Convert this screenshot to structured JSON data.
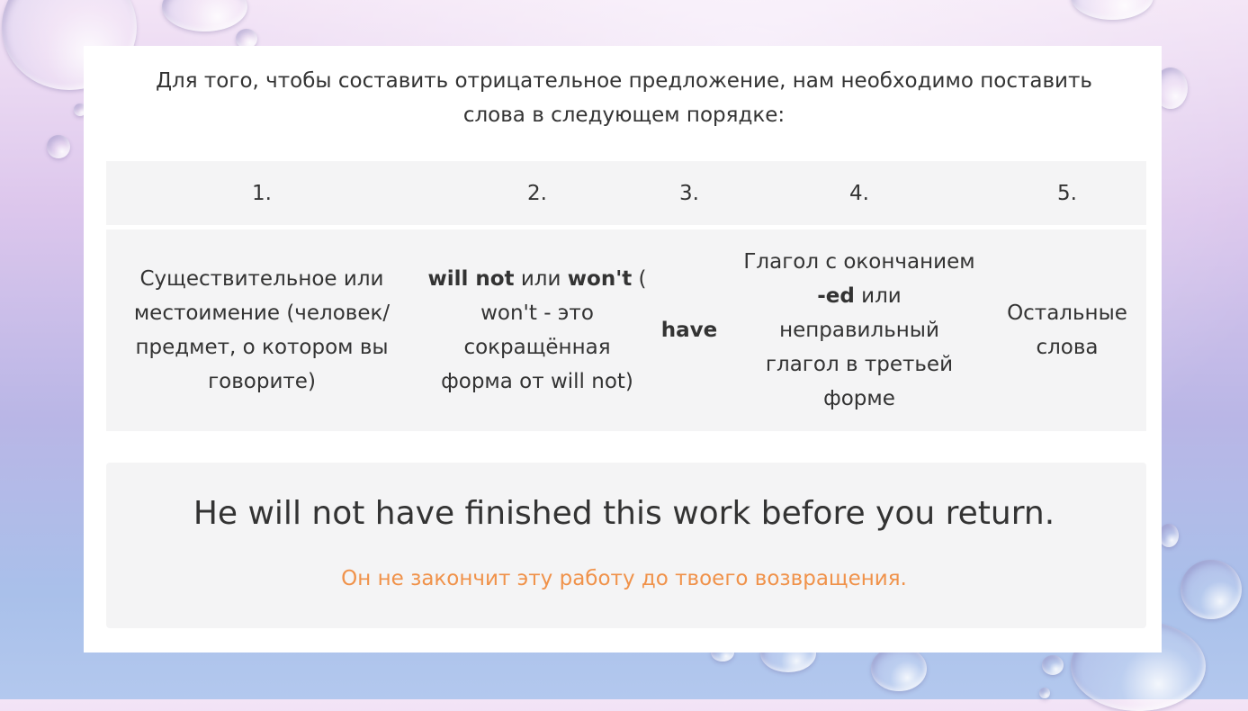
{
  "intro": {
    "line1": "Для того, чтобы составить отрицательное предложение, нам необходимо поставить",
    "line2": "слова в следующем порядке:"
  },
  "table": {
    "headers": [
      "1.",
      "2.",
      "3.",
      "4.",
      "5."
    ],
    "col1": [
      "Существительное или",
      "местоимение (человек/",
      "предмет, о котором вы",
      "говорите)"
    ],
    "col2": {
      "bold1": "will not",
      "mid": " или ",
      "bold2": "won't",
      "tail": " (",
      "line2": "won't - это",
      "line3": "сокращённая",
      "line4": "форма от will not)"
    },
    "col3": "have",
    "col4": {
      "line1": "Глагол с окончанием",
      "bold": "-ed",
      "after_bold": " или",
      "line3": "неправильный",
      "line4": "глагол в третьей",
      "line5": "форме"
    },
    "col5": [
      "Остальные",
      "слова"
    ]
  },
  "example": {
    "english": "He will not have finished this work before you return.",
    "russian": "Он не закончит эту работу до твоего возвращения.",
    "russian_color": "#f0924a"
  }
}
